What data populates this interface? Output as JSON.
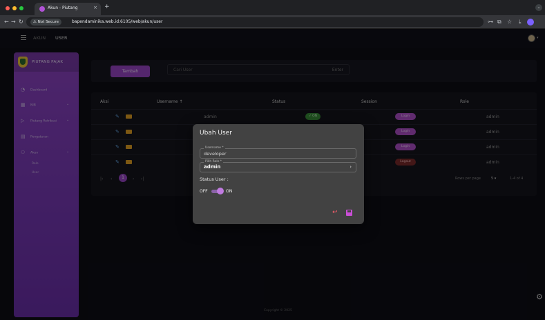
{
  "browser": {
    "tab_title": "Akun - Piutang",
    "tab_close": "×",
    "new_tab": "+",
    "security_chip": "⚠ Not Secure",
    "url": "bapendaminika.web.id:6105/web/akun/user",
    "nav_back": "←",
    "nav_forward": "→",
    "nav_reload": "↻",
    "win_ctrl": "⌄",
    "ext_icons": [
      "⊶",
      "⧉",
      "☆",
      "⤓"
    ]
  },
  "topbar": {
    "breadcrumb": [
      "AKUN",
      "USER"
    ]
  },
  "sidebar": {
    "brand": "PIUTANG PAJAK",
    "items": [
      {
        "icon": "◔",
        "label": "Dashboard",
        "caret": ""
      },
      {
        "icon": "▦",
        "label": "NIB",
        "caret": "⌄"
      },
      {
        "icon": "▷",
        "label": "Piutang Retribusi",
        "caret": "⌄"
      },
      {
        "icon": "▤",
        "label": "Pengaturan",
        "caret": ""
      },
      {
        "icon": "⚇",
        "label": "Akun",
        "caret": "⌄"
      }
    ],
    "sub_items": [
      "Role",
      "User"
    ]
  },
  "search": {
    "add_label": "Tambah",
    "placeholder": "Cari User",
    "enter_hint": "Enter"
  },
  "table": {
    "headers": {
      "aksi": "Aksi",
      "username": "Username ↑",
      "status": "Status",
      "session": "Session",
      "role": "Role"
    },
    "rows": [
      {
        "username": "admin",
        "status": "✓ ON",
        "session": "Login",
        "role": "admin"
      },
      {
        "username": "",
        "status": "",
        "session": "Login",
        "role": "admin"
      },
      {
        "username": "",
        "status": "",
        "session": "Login",
        "role": "admin"
      },
      {
        "username": "",
        "status": "",
        "session": "Logout",
        "role": "admin"
      }
    ],
    "pager": {
      "first": "|‹",
      "prev": "‹",
      "current": "1",
      "next": "›",
      "last": "›|"
    },
    "rows_per_page_label": "Rows per page",
    "rows_per_page_value": "5 ▾",
    "range": "1-4 of 4"
  },
  "footer": {
    "text": "Copyright © 2025"
  },
  "modal": {
    "title": "Ubah User",
    "username_label": "Username *",
    "username_value": "developer",
    "role_label": "Pilih Role *",
    "role_value": "admin",
    "role_chevron": "›",
    "status_label": "Status User :",
    "off_label": "OFF",
    "on_label": "ON",
    "status_on": true,
    "undo_icon": "↩"
  },
  "colors": {
    "accent": "#9a46c7",
    "sidebar_top": "#8e44c4",
    "undo": "#ff5f6d",
    "save": "#c94ed6",
    "status_on": "#3a8e3a"
  }
}
